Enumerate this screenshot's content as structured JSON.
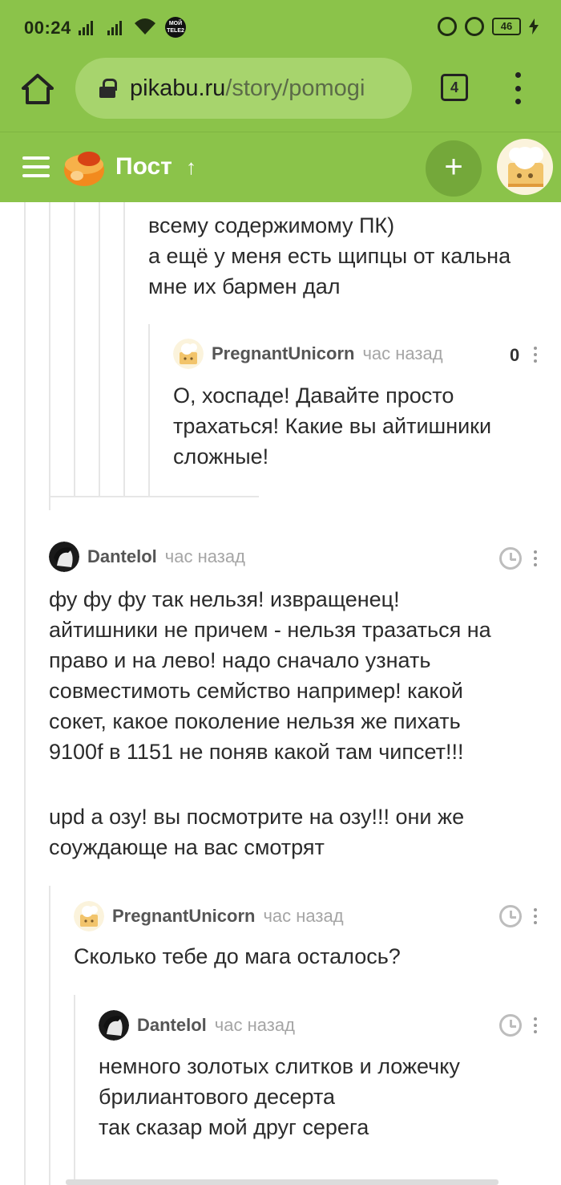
{
  "status_bar": {
    "time": "00:24",
    "app_badge": "МОЙ TELE2",
    "battery": "46"
  },
  "browser": {
    "url_domain": "pikabu.ru",
    "url_path": "/story/pomogi",
    "tab_count": "4"
  },
  "app_header": {
    "title": "Пост",
    "up_arrow": "↑",
    "add_label": "+"
  },
  "comments": {
    "c0": {
      "lines": [
        "всему содержимому ПК)",
        "а ещё у меня есть щипцы от кальна",
        "мне их бармен дал"
      ]
    },
    "c1": {
      "author": "PregnantUnicorn",
      "time": "час назад",
      "rating": "0",
      "lines": [
        "О, хоспаде! Давайте просто",
        "трахаться! Какие вы айтишники",
        "сложные!"
      ]
    },
    "c2": {
      "author": "Dantelol",
      "time": "час назад",
      "lines": [
        "фу фу фу так нельзя! извращенец!",
        "айтишники не причем - нельзя тразаться на",
        "право и на лево! надо сначало узнать",
        "совместимоть семйство например! какой",
        "сокет, какое поколение нельзя же пихать",
        "9100f в 1151 не поняв какой там чипсет!!!",
        "",
        "upd а озу! вы посмотрите на озу!!! они же",
        "соуждающе на вас смотрят"
      ]
    },
    "c3": {
      "author": "PregnantUnicorn",
      "time": "час назад",
      "lines": [
        "Сколько тебе до мага осталось?"
      ]
    },
    "c4": {
      "author": "Dantelol",
      "time": "час назад",
      "lines": [
        "немного золотых слитков и ложечку",
        "брилиантового десерта",
        "так сказар мой друг серега"
      ]
    }
  },
  "colors": {
    "brand_green": "#8bc34a",
    "url_box": "#a7d46d",
    "add_button": "#74a83a"
  }
}
